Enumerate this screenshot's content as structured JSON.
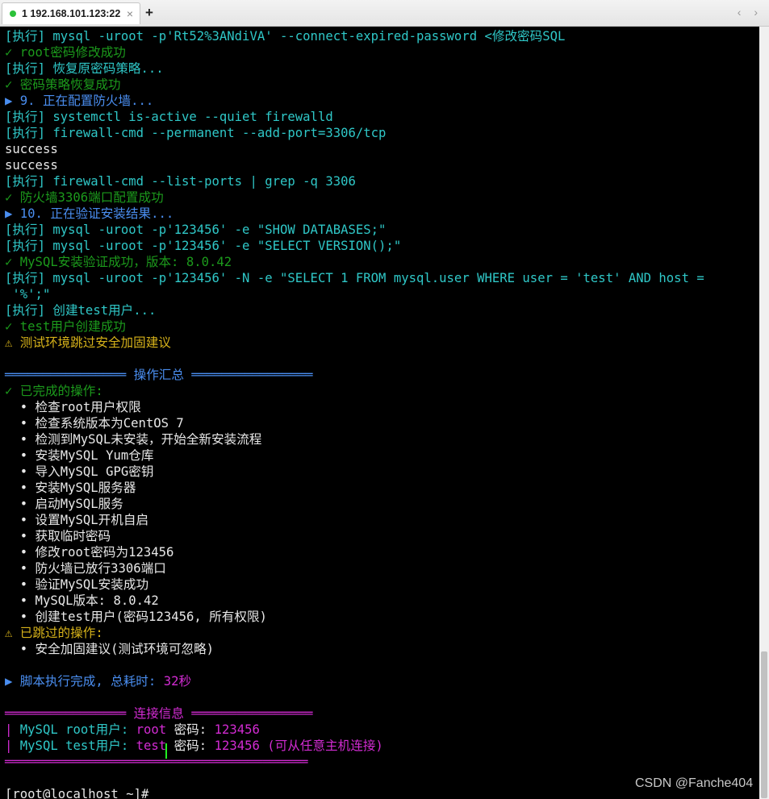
{
  "tab": {
    "title": "1 192.168.101.123:22",
    "close": "×",
    "add": "+",
    "nav": "‹ ›"
  },
  "lines": [
    {
      "text": "[执行] mysql -uroot -p'Rt52%3ANdiVA' --connect-expired-password <修改密码SQL",
      "color": "cyan"
    },
    {
      "text": "✓ root密码修改成功",
      "color": "green"
    },
    {
      "text": "[执行] 恢复原密码策略...",
      "color": "cyan"
    },
    {
      "text": "✓ 密码策略恢复成功",
      "color": "green"
    },
    {
      "text": "▶ 9. 正在配置防火墙...",
      "color": "blue"
    },
    {
      "text": "[执行] systemctl is-active --quiet firewalld",
      "color": "cyan"
    },
    {
      "text": "[执行] firewall-cmd --permanent --add-port=3306/tcp",
      "color": "cyan"
    },
    {
      "text": "success",
      "color": "white"
    },
    {
      "text": "success",
      "color": "white"
    },
    {
      "text": "[执行] firewall-cmd --list-ports | grep -q 3306",
      "color": "cyan"
    },
    {
      "text": "✓ 防火墙3306端口配置成功",
      "color": "green"
    },
    {
      "text": "▶ 10. 正在验证安装结果...",
      "color": "blue"
    },
    {
      "text": "[执行] mysql -uroot -p'123456' -e \"SHOW DATABASES;\"",
      "color": "cyan"
    },
    {
      "text": "[执行] mysql -uroot -p'123456' -e \"SELECT VERSION();\"",
      "color": "cyan"
    },
    {
      "text": "✓ MySQL安装验证成功，版本: 8.0.42",
      "color": "green"
    },
    {
      "text": "[执行] mysql -uroot -p'123456' -N -e \"SELECT 1 FROM mysql.user WHERE user = 'test' AND host =",
      "color": "cyan"
    },
    {
      "text": " '%';\"",
      "color": "cyan"
    },
    {
      "text": "[执行] 创建test用户...",
      "color": "cyan"
    },
    {
      "text": "✓ test用户创建成功",
      "color": "green"
    },
    {
      "text": "⚠ 测试环境跳过安全加固建议",
      "color": "yellow"
    },
    {
      "text": "",
      "color": "white"
    },
    {
      "text": "════════════════ 操作汇总 ════════════════",
      "color": "blue"
    },
    {
      "text": "✓ 已完成的操作:",
      "color": "green"
    },
    {
      "text": "  • 检查root用户权限",
      "color": "white"
    },
    {
      "text": "  • 检查系统版本为CentOS 7",
      "color": "white"
    },
    {
      "text": "  • 检测到MySQL未安装，开始全新安装流程",
      "color": "white"
    },
    {
      "text": "  • 安装MySQL Yum仓库",
      "color": "white"
    },
    {
      "text": "  • 导入MySQL GPG密钥",
      "color": "white"
    },
    {
      "text": "  • 安装MySQL服务器",
      "color": "white"
    },
    {
      "text": "  • 启动MySQL服务",
      "color": "white"
    },
    {
      "text": "  • 设置MySQL开机自启",
      "color": "white"
    },
    {
      "text": "  • 获取临时密码",
      "color": "white"
    },
    {
      "text": "  • 修改root密码为123456",
      "color": "white"
    },
    {
      "text": "  • 防火墙已放行3306端口",
      "color": "white"
    },
    {
      "text": "  • 验证MySQL安装成功",
      "color": "white"
    },
    {
      "text": "  • MySQL版本: 8.0.42",
      "color": "white"
    },
    {
      "text": "  • 创建test用户(密码123456, 所有权限)",
      "color": "white"
    },
    {
      "text": "⚠ 已跳过的操作:",
      "color": "yellow"
    },
    {
      "text": "  • 安全加固建议(测试环境可忽略)",
      "color": "white"
    },
    {
      "text": "",
      "color": "white"
    },
    {
      "text": "",
      "color": "white",
      "segments": [
        {
          "text": "▶ 脚本执行完成, 总耗时: ",
          "color": "blue"
        },
        {
          "text": "32秒",
          "color": "magenta"
        }
      ]
    },
    {
      "text": "",
      "color": "white"
    },
    {
      "text": "════════════════ 连接信息 ════════════════",
      "color": "magenta"
    },
    {
      "text": "",
      "color": "white",
      "segments": [
        {
          "text": "| ",
          "color": "magenta"
        },
        {
          "text": "MySQL root用户: ",
          "color": "cyan"
        },
        {
          "text": "root",
          "color": "magenta"
        },
        {
          "text": " 密码: ",
          "color": "white"
        },
        {
          "text": "123456",
          "color": "magenta"
        }
      ]
    },
    {
      "text": "",
      "color": "white",
      "segments": [
        {
          "text": "| ",
          "color": "magenta"
        },
        {
          "text": "MySQL test用户: ",
          "color": "cyan"
        },
        {
          "text": "test",
          "color": "magenta"
        },
        {
          "text": " 密码: ",
          "color": "white"
        },
        {
          "text": "123456 (可从任意主机连接)",
          "color": "magenta"
        }
      ]
    },
    {
      "text": "════════════════════════════════════════",
      "color": "magenta"
    },
    {
      "text": "",
      "color": "white"
    },
    {
      "text": "[root@localhost ~]# ",
      "color": "white"
    }
  ],
  "watermark": "CSDN @Fanche404"
}
